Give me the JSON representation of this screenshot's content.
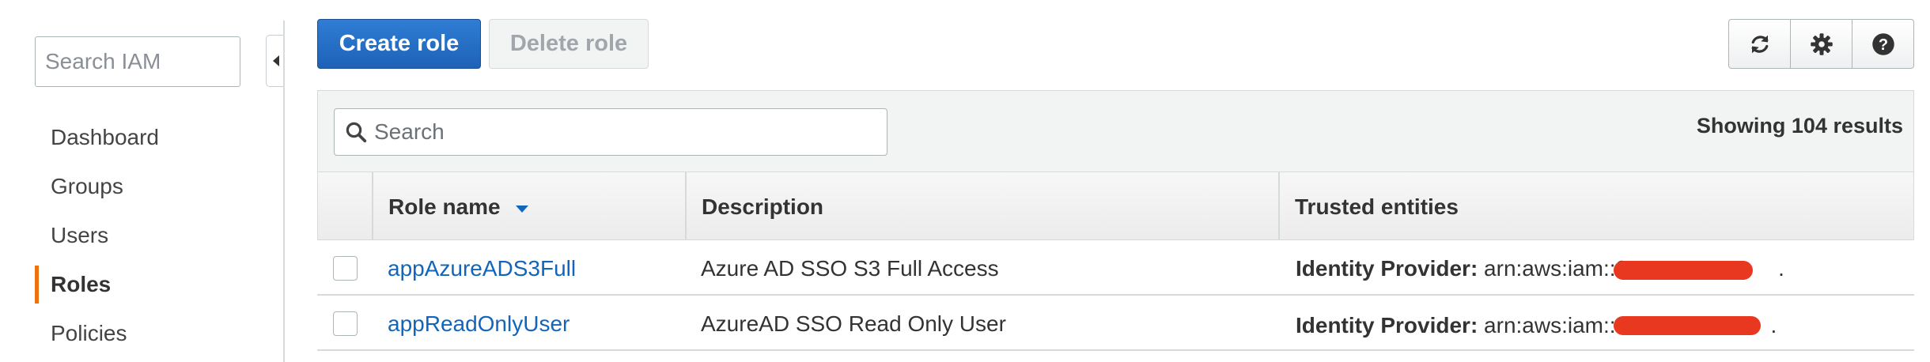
{
  "sidebar": {
    "search_placeholder": "Search IAM",
    "items": [
      {
        "label": "Dashboard"
      },
      {
        "label": "Groups"
      },
      {
        "label": "Users"
      },
      {
        "label": "Roles"
      },
      {
        "label": "Policies"
      }
    ],
    "active": "Roles",
    "accent_color": "#ec7211"
  },
  "toolbar": {
    "create_label": "Create role",
    "delete_label": "Delete role",
    "icons": [
      "refresh-icon",
      "gear-icon",
      "help-icon"
    ]
  },
  "table": {
    "search_placeholder": "Search",
    "results_text": "Showing 104 results",
    "columns": {
      "role_name": "Role name",
      "description": "Description",
      "trusted_entities": "Trusted entities"
    },
    "rows": [
      {
        "role_name": "appAzureADS3Full",
        "description": "Azure AD SSO S3 Full Access",
        "trusted_label": "Identity Provider:",
        "trusted_value": "arn:aws:iam::2",
        "trusted_suffix": "."
      },
      {
        "role_name": "appReadOnlyUser",
        "description": "AzureAD SSO Read Only User",
        "trusted_label": "Identity Provider:",
        "trusted_value": "arn:aws:iam::",
        "trusted_suffix": "."
      }
    ]
  },
  "colors": {
    "link": "#1166bb",
    "primary_button": "#1e62b8",
    "redaction": "#e8381f"
  }
}
